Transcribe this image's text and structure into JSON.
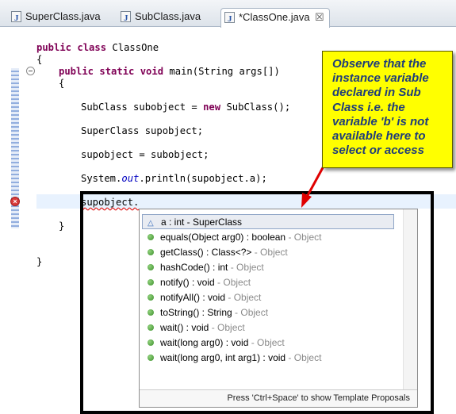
{
  "tabs": [
    {
      "label": "SuperClass.java",
      "active": false
    },
    {
      "label": "SubClass.java",
      "active": false
    },
    {
      "label": "*ClassOne.java",
      "active": true,
      "close": "☒"
    }
  ],
  "editor": {
    "line1_kw": "public class",
    "line1_name": " ClassOne",
    "brace_open": "{",
    "main_kw": "public static void",
    "main_rest": " main(String args[])",
    "inner_brace_open": "{",
    "sub_decl_a": "SubClass subobject = ",
    "sub_decl_kw": "new",
    "sub_decl_b": " SubClass();",
    "sup_decl": "SuperClass supobject;",
    "assign": "supobject = subobject;",
    "print_a": "System.",
    "print_out": "out",
    "print_b": ".println(supobject.a);",
    "error_line": "supobject.",
    "inner_brace_close": "}",
    "brace_close": "}",
    "error_marker": "×"
  },
  "callout": {
    "text": "Observe that the instance variable declared in Sub Class i.e. the variable 'b' is not available here to select or access"
  },
  "completion": {
    "items": [
      {
        "label": "a : int - SuperClass",
        "owner": "",
        "kind": "field",
        "selected": true
      },
      {
        "label": "equals(Object arg0) : boolean",
        "owner": " - Object",
        "kind": "method"
      },
      {
        "label": "getClass() : Class<?>",
        "owner": " - Object",
        "kind": "method"
      },
      {
        "label": "hashCode() : int",
        "owner": " - Object",
        "kind": "method"
      },
      {
        "label": "notify() : void",
        "owner": " - Object",
        "kind": "method"
      },
      {
        "label": "notifyAll() : void",
        "owner": " - Object",
        "kind": "method"
      },
      {
        "label": "toString() : String",
        "owner": " - Object",
        "kind": "method"
      },
      {
        "label": "wait() : void",
        "owner": " - Object",
        "kind": "method"
      },
      {
        "label": "wait(long arg0) : void",
        "owner": " - Object",
        "kind": "method"
      },
      {
        "label": "wait(long arg0, int arg1) : void",
        "owner": " - Object",
        "kind": "method"
      }
    ],
    "footer": "Press 'Ctrl+Space' to show Template Proposals"
  },
  "colors": {
    "keyword": "#7f0055",
    "static_field": "#0000c0",
    "callout_bg": "#ffff00",
    "callout_text": "#1f3d7a",
    "arrow": "#e00000"
  }
}
